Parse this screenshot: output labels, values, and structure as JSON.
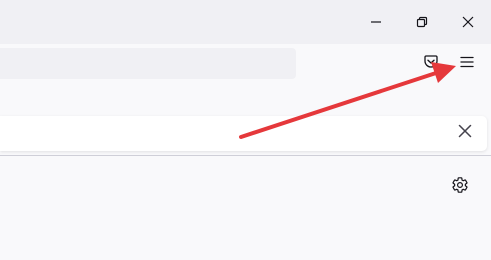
{
  "window_controls": {
    "minimize_icon": "minimize-icon",
    "restore_icon": "restore-icon",
    "close_icon": "close-icon"
  },
  "toolbar": {
    "pocket_icon": "pocket-icon",
    "menu_icon": "hamburger-menu-icon"
  },
  "notification_bar": {
    "close_icon": "close-icon"
  },
  "content": {
    "settings_icon": "gear-icon"
  },
  "annotation": {
    "arrow_color": "#e5383b",
    "points_to": "application-menu-button"
  },
  "colors": {
    "titlebar_bg": "#f0f0f4",
    "page_bg": "#f9f9fb",
    "urlbar_bg": "#f0f0f4",
    "notif_bg": "#ffffff",
    "icon_color": "#15141a"
  }
}
